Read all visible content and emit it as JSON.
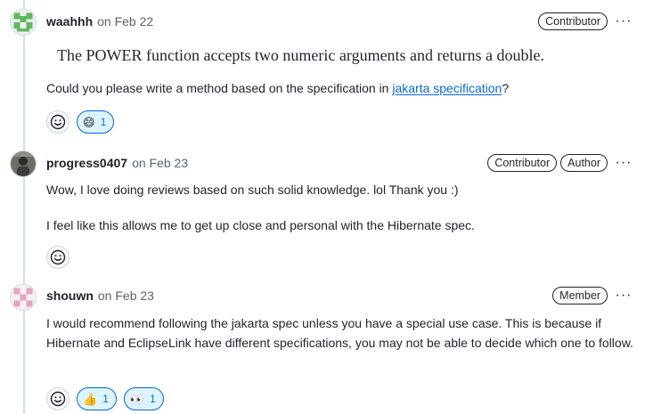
{
  "comments": [
    {
      "author": "waahhh",
      "date": "on Feb 22",
      "badges": [
        "Contributor"
      ],
      "quote": "The POWER function accepts two numeric arguments and returns a double.",
      "text_before_link": "Could you please write a method based on the specification in ",
      "link_text": "jakarta specification",
      "text_after_link": "?",
      "reactions": [
        {
          "emoji": "😄",
          "icon": "smile-emoji-icon",
          "count": "1"
        }
      ]
    },
    {
      "author": "progress0407",
      "date": "on Feb 23",
      "badges": [
        "Contributor",
        "Author"
      ],
      "paragraphs": [
        "Wow, I love doing reviews based on such solid knowledge. lol Thank you :)",
        "I feel like this allows me to get up close and personal with the Hibernate spec."
      ],
      "reactions": []
    },
    {
      "author": "shouwn",
      "date": "on Feb 23",
      "badges": [
        "Member"
      ],
      "paragraphs": [
        "I would recommend following the jakarta spec unless you have a special use case. This is because if Hibernate and EclipseLink have different specifications, you may not be able to decide which one to follow."
      ],
      "reactions": [
        {
          "emoji": "👍",
          "icon": "thumbs-up-emoji-icon",
          "count": "1"
        },
        {
          "emoji": "👀",
          "icon": "eyes-emoji-icon",
          "count": "1"
        }
      ]
    }
  ],
  "kebab_glyph": "···",
  "colors": {
    "link": "#0969da",
    "reaction_active_bg": "#ddf4ff",
    "border": "#d0d7de"
  }
}
